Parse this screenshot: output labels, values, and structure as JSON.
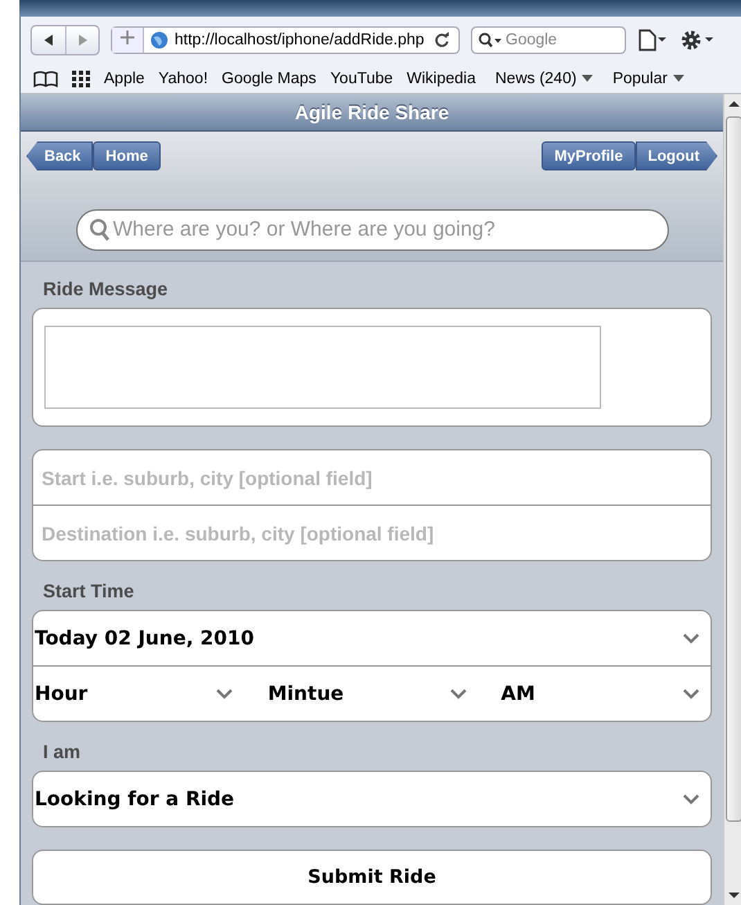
{
  "browser": {
    "url": "http://localhost/iphone/addRide.php",
    "search_placeholder": "Google",
    "bookmarks": [
      {
        "label": "Apple",
        "menu": false
      },
      {
        "label": "Yahoo!",
        "menu": false
      },
      {
        "label": "Google Maps",
        "menu": false
      },
      {
        "label": "YouTube",
        "menu": false
      },
      {
        "label": "Wikipedia",
        "menu": false
      },
      {
        "label": "News (240)",
        "menu": true
      },
      {
        "label": "Popular",
        "menu": true
      }
    ]
  },
  "header": {
    "title": "Agile Ride Share"
  },
  "nav": {
    "left": [
      {
        "label": "Back",
        "kind": "back"
      },
      {
        "label": "Home",
        "kind": "plain"
      }
    ],
    "right": [
      {
        "label": "MyProfile",
        "kind": "plain"
      },
      {
        "label": "Logout",
        "kind": "forward"
      }
    ]
  },
  "search": {
    "placeholder": "Where are you? or Where are you going?"
  },
  "message": {
    "label": "Ride Message"
  },
  "locations": [
    {
      "placeholder": "Start i.e. suburb, city [optional field]"
    },
    {
      "placeholder": "Destination i.e. suburb, city [optional field]"
    }
  ],
  "start_time": {
    "label": "Start Time",
    "date": "Today 02 June, 2010",
    "parts": [
      "Hour",
      "Mintue",
      "AM"
    ]
  },
  "role": {
    "label": "I am",
    "value": "Looking for a Ride"
  },
  "submit": {
    "label": "Submit Ride"
  }
}
